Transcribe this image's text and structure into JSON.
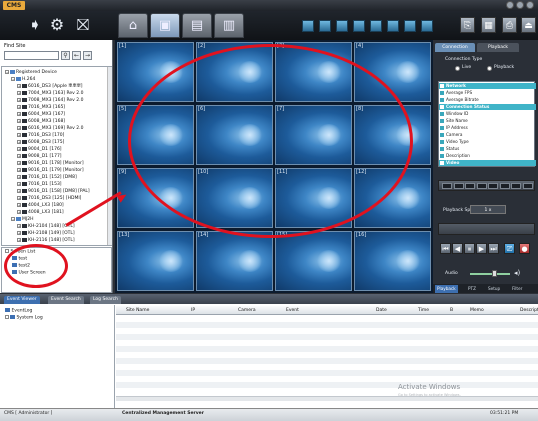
{
  "app": {
    "logo": "CMS"
  },
  "left": {
    "find_label": "Find Site",
    "tree": [
      {
        "label": "Registered Device",
        "level": 0
      },
      {
        "label": "H.264",
        "level": 1
      },
      {
        "label": "6016_DS3 [Apple 뽀뽀뽀]",
        "level": 2
      },
      {
        "label": "7004_MX3 [163] Rev 2.0",
        "level": 2
      },
      {
        "label": "7008_MX3 [164] Rev 2.0",
        "level": 2
      },
      {
        "label": "7016_MX3 [165]",
        "level": 2
      },
      {
        "label": "6004_MX3 [167]",
        "level": 2
      },
      {
        "label": "6008_MX3 [168]",
        "level": 2
      },
      {
        "label": "6016_MX3 [169] Rev 2.0",
        "level": 2
      },
      {
        "label": "7016_DS3 [170]",
        "level": 2
      },
      {
        "label": "6008_DS3 [175]",
        "level": 2
      },
      {
        "label": "9004_D1 [176]",
        "level": 2
      },
      {
        "label": "9008_D1 [177]",
        "level": 2
      },
      {
        "label": "9016_D1 [178] [Monitor]",
        "level": 2
      },
      {
        "label": "9016_D1 [179] [Monitor]",
        "level": 2
      },
      {
        "label": "7016_D1 [152] [DM8]",
        "level": 2
      },
      {
        "label": "7016_D1 [153]",
        "level": 2
      },
      {
        "label": "9016_D1 [158] [DM8] [PAL]",
        "level": 2
      },
      {
        "label": "7016_DS3 [125] [HDMI]",
        "level": 2
      },
      {
        "label": "4004_LX3 [180]",
        "level": 2
      },
      {
        "label": "4008_LX3 [181]",
        "level": 2
      },
      {
        "label": "MJ2H",
        "level": 1
      },
      {
        "label": "KH-2104 [148] [OTL]",
        "level": 2
      },
      {
        "label": "KH-2108 [149] [OTL]",
        "level": 2
      },
      {
        "label": "KH-2116 [148] [OTL]",
        "level": 2
      }
    ],
    "screen_list": {
      "title": "Screen List",
      "items": [
        "test",
        "test2",
        "User Screen"
      ]
    }
  },
  "grid": {
    "cells": [
      "[1]",
      "[2]",
      "[3]",
      "[4]",
      "[5]",
      "[6]",
      "[7]",
      "[8]",
      "[9]",
      "[10]",
      "[11]",
      "[12]",
      "[13]",
      "[14]",
      "[15]",
      "[16]"
    ]
  },
  "right": {
    "tabs": {
      "connection": "Connection",
      "playback": "Playback"
    },
    "connection_type": "Connection Type",
    "radio_live": "Live",
    "radio_playback": "Playback",
    "info_rows": [
      {
        "label": "Network",
        "section": true
      },
      {
        "label": "Average FPS",
        "section": false
      },
      {
        "label": "Average Bitrate",
        "section": false
      },
      {
        "label": "Connection Status",
        "section": true
      },
      {
        "label": "Window ID",
        "section": false
      },
      {
        "label": "Site Name",
        "section": false
      },
      {
        "label": "IP Address",
        "section": false
      },
      {
        "label": "Camera",
        "section": false
      },
      {
        "label": "Video Type",
        "section": false
      },
      {
        "label": "Status",
        "section": false
      },
      {
        "label": "Description",
        "section": false
      },
      {
        "label": "Video",
        "section": true
      }
    ],
    "playback_speed": "Playback Speed",
    "speed_value": "1 x",
    "audio": "Audio",
    "bottom_tabs": [
      "Playback",
      "PTZ",
      "Setup",
      "Filter"
    ]
  },
  "bottom": {
    "tabs": [
      "Event Viewer",
      "Event Search",
      "Log Search"
    ],
    "log_tree": [
      "EventLog",
      "System Log"
    ],
    "columns": [
      "Site Name",
      "IP",
      "Camera",
      "Event",
      "Date",
      "Time",
      "B",
      "Memo",
      "Descript"
    ]
  },
  "watermark": {
    "title": "Activate Windows",
    "sub": "Go to Settings to activate Windows."
  },
  "status": {
    "user": "CMS [ Administrator ]",
    "server": "Centralized Management Server",
    "time": "03:51:21 PM"
  },
  "colors": {
    "accent": "#3fb4c8",
    "annotation": "#e0121f"
  }
}
